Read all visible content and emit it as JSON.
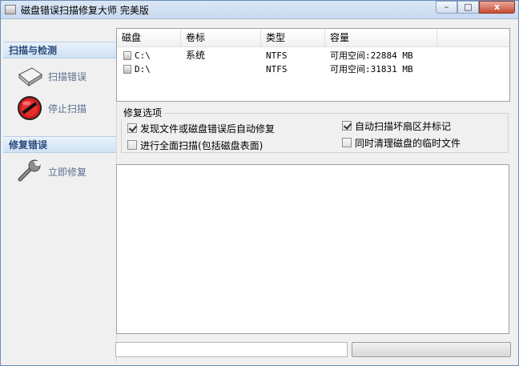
{
  "window": {
    "title": "磁盘错误扫描修复大师 完美版",
    "min_label": "–",
    "max_label": "□",
    "close_label": "x"
  },
  "sidebar": {
    "section_scan": "扫描与检测",
    "scan_item": "扫描错误",
    "stop_item": "停止扫描",
    "section_repair": "修复错误",
    "repair_item": "立即修复"
  },
  "drives": {
    "columns": [
      "磁盘",
      "卷标",
      "类型",
      "容量"
    ],
    "rows": [
      {
        "disk": "C:\\",
        "label": "系统",
        "type": "NTFS",
        "capacity": "可用空间:22884 MB"
      },
      {
        "disk": "D:\\",
        "label": "",
        "type": "NTFS",
        "capacity": "可用空间:31831 MB"
      }
    ]
  },
  "options": {
    "title": "修复选项",
    "items": [
      {
        "label": "发现文件或磁盘错误后自动修复",
        "checked": true
      },
      {
        "label": "进行全面扫描(包括磁盘表面)",
        "checked": false
      },
      {
        "label": "自动扫描坏扇区并标记",
        "checked": true
      },
      {
        "label": "同时清理磁盘的临时文件",
        "checked": false
      }
    ]
  },
  "log": {
    "text": ""
  },
  "status": {
    "text": "",
    "progress": 0
  },
  "colors": {
    "accent": "#2a4b7c",
    "close": "#c74a34"
  }
}
